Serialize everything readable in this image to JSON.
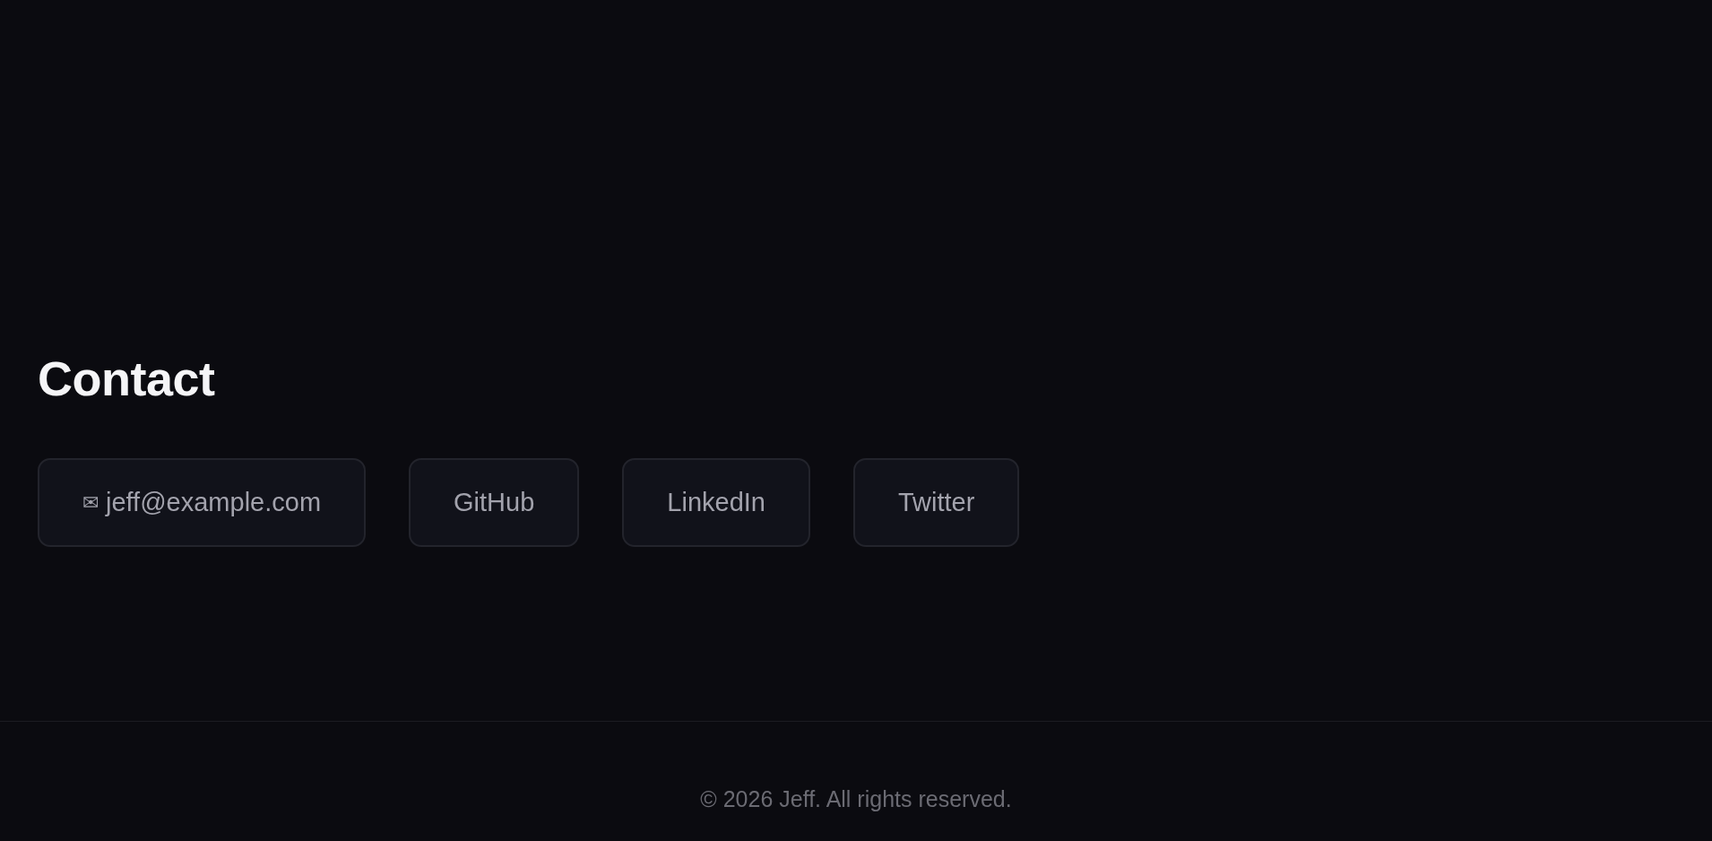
{
  "contact": {
    "title": "Contact",
    "links": [
      {
        "kind": "email",
        "icon": "✉",
        "label": "jeff@example.com"
      },
      {
        "kind": "plain",
        "label": "GitHub"
      },
      {
        "kind": "plain",
        "label": "LinkedIn"
      },
      {
        "kind": "plain",
        "label": "Twitter"
      }
    ]
  },
  "footer": {
    "text": "© 2026 Jeff. All rights reserved."
  }
}
